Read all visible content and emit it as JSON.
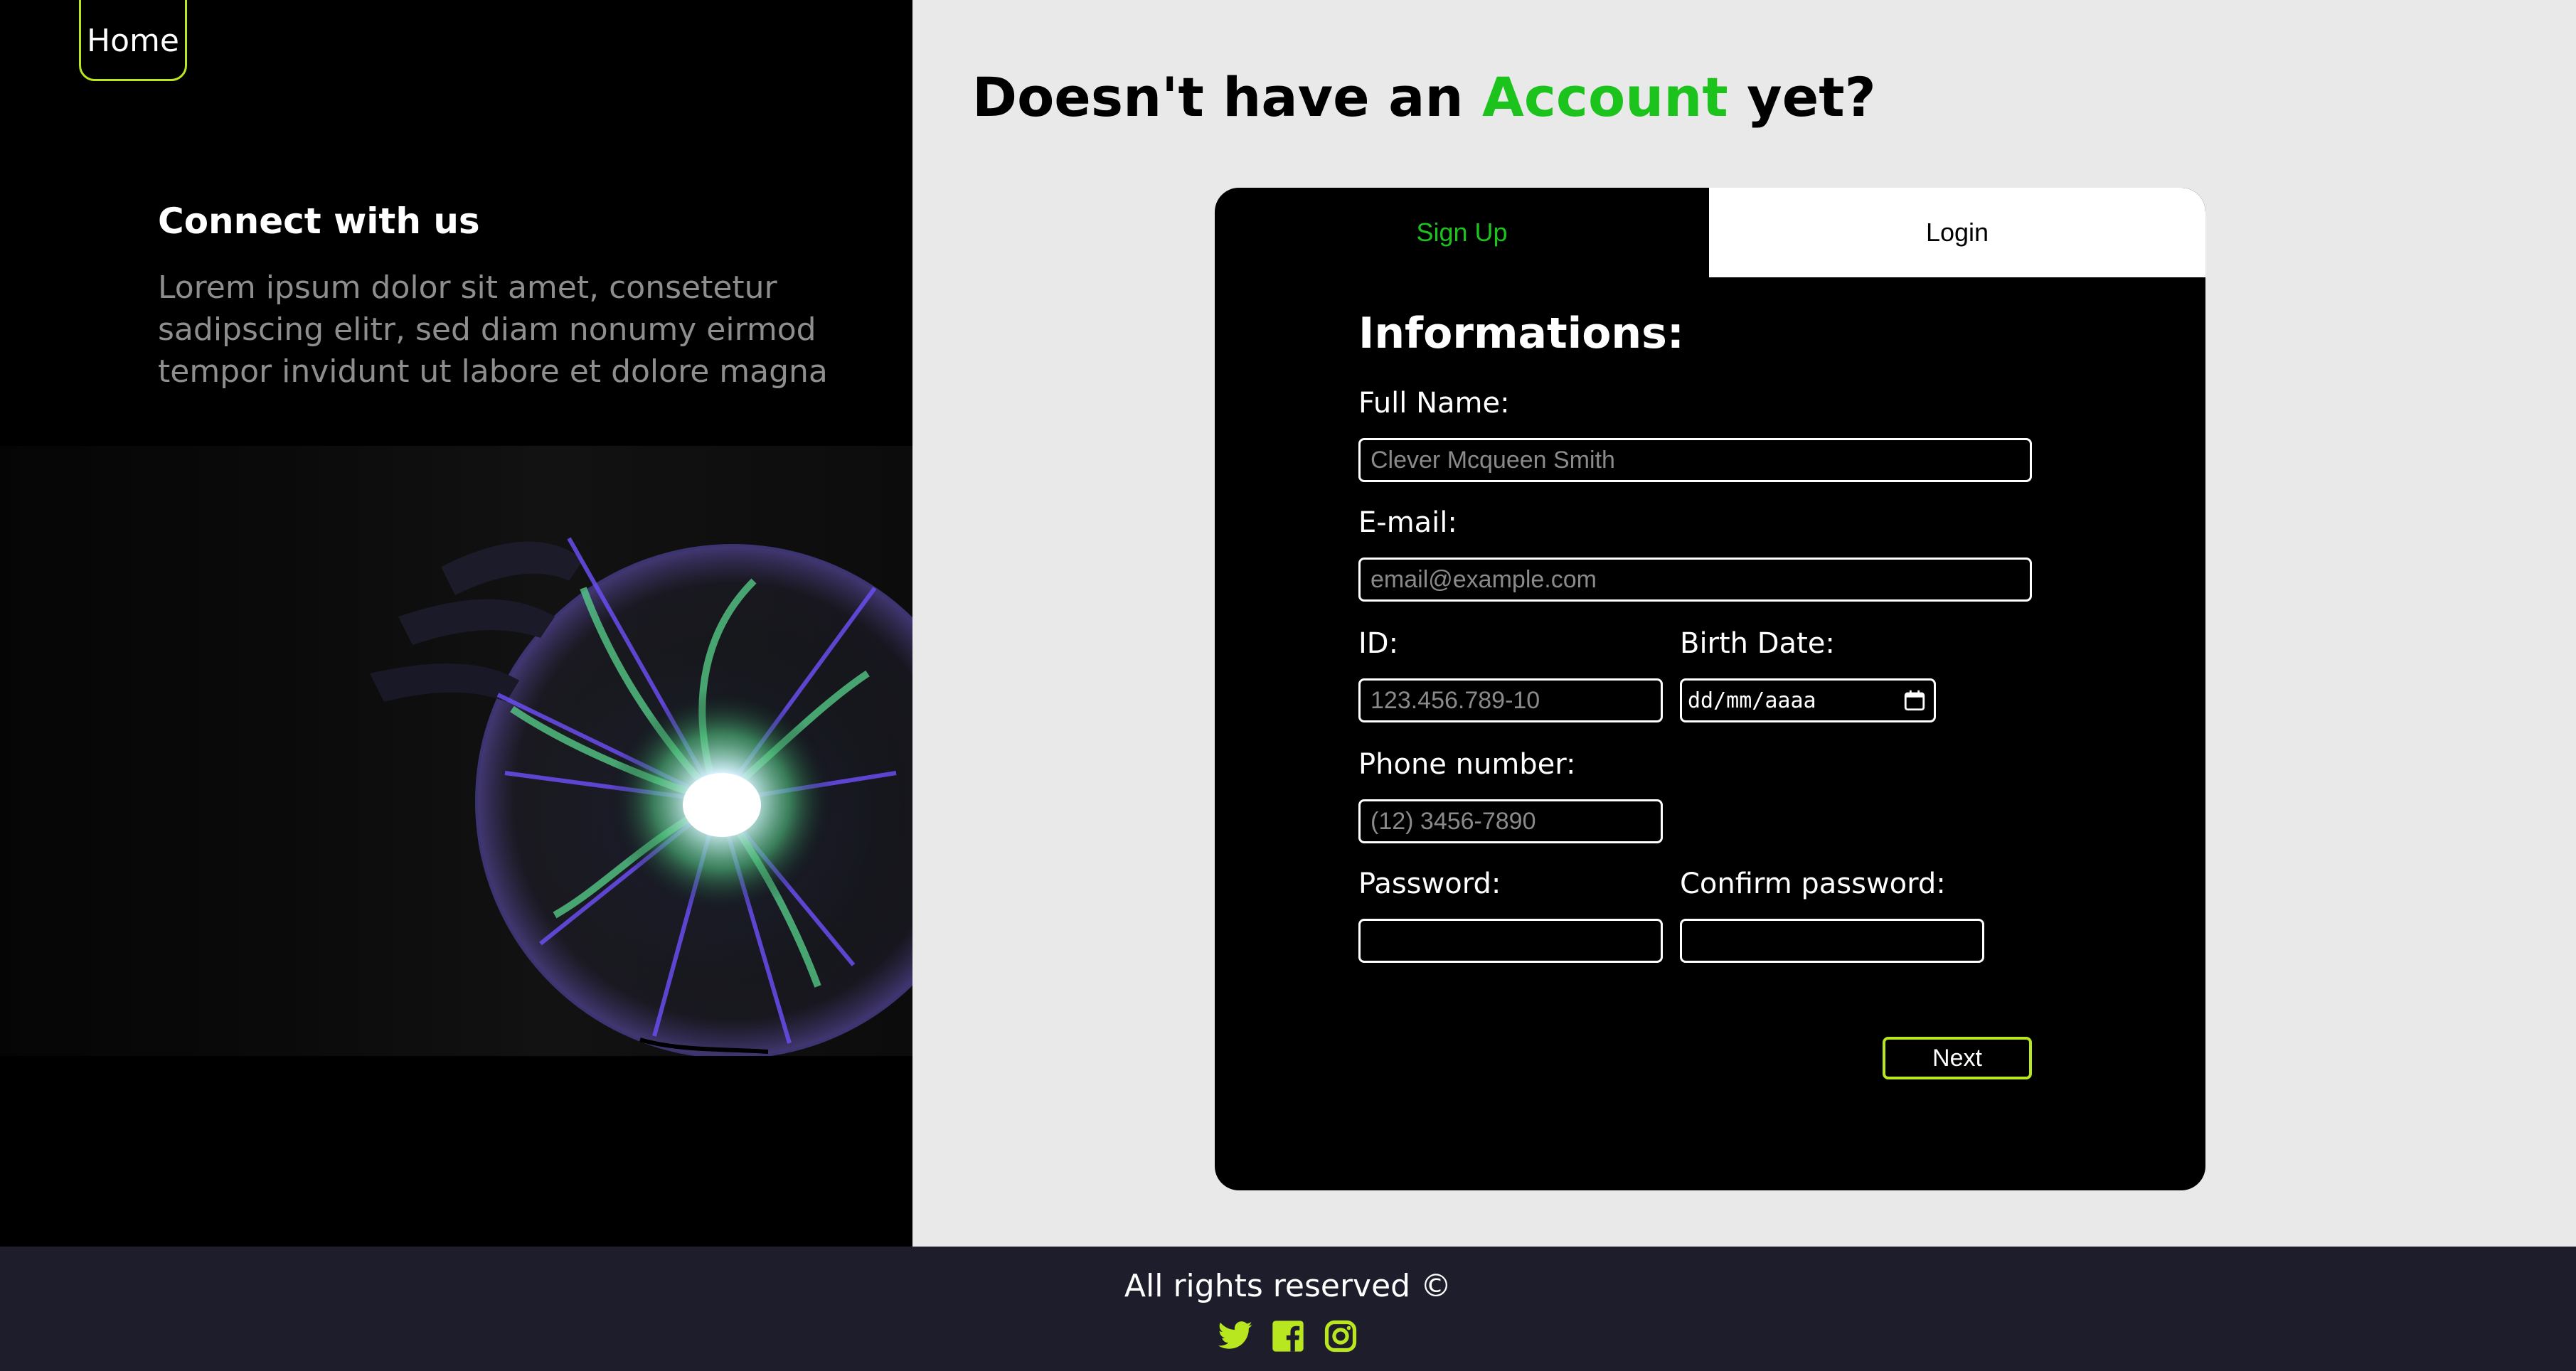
{
  "nav": {
    "home_label": "Home"
  },
  "hero": {
    "title": "Connect with us",
    "text": "Lorem ipsum dolor sit amet, consetetur sadipscing elitr, sed diam nonumy eirmod tempor invidunt ut labore et dolore magna"
  },
  "headline": {
    "prefix": "Doesn't have an ",
    "accent": "Account",
    "suffix": " yet?"
  },
  "tabs": {
    "signup": "Sign Up",
    "login": "Login"
  },
  "form": {
    "title": "Informations:",
    "full_name": {
      "label": "Full Name:",
      "placeholder": "Clever Mcqueen Smith"
    },
    "email": {
      "label": "E-mail:",
      "placeholder": "email@example.com"
    },
    "id": {
      "label": "ID:",
      "placeholder": "123.456.789-10"
    },
    "birth_date": {
      "label": "Birth Date:",
      "placeholder": "dd/mm/aaaa"
    },
    "phone": {
      "label": "Phone number:",
      "placeholder": "(12) 3456-7890"
    },
    "password": {
      "label": "Password:"
    },
    "confirm_password": {
      "label": "Confirm password:"
    },
    "next_label": "Next"
  },
  "footer": {
    "copyright": "All rights reserved ©",
    "social_icons": [
      "twitter-icon",
      "facebook-icon",
      "instagram-icon"
    ]
  },
  "colors": {
    "accent_green": "#1cc31c",
    "lime_border": "#b8e61f",
    "panel_bg": "#e8e9e8",
    "footer_bg": "#1e1d2b",
    "card_bg": "#000000"
  }
}
